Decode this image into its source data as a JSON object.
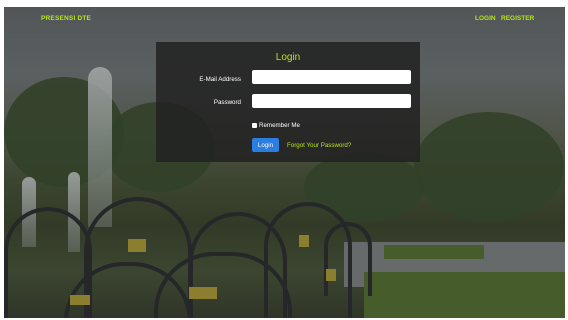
{
  "navbar": {
    "brand": "PRESENSI DTE",
    "login_link": "LOGIN",
    "register_link": "REGISTER"
  },
  "login_card": {
    "title": "Login",
    "email_label": "E-Mail Address",
    "email_value": "",
    "password_label": "Password",
    "password_value": "",
    "remember_label": "Remember Me",
    "login_button": "Login",
    "forgot_link": "Forgot Your Password?"
  },
  "colors": {
    "accent": "#b7e61e",
    "primary_button": "#2a7de1",
    "card_bg": "#222222"
  }
}
